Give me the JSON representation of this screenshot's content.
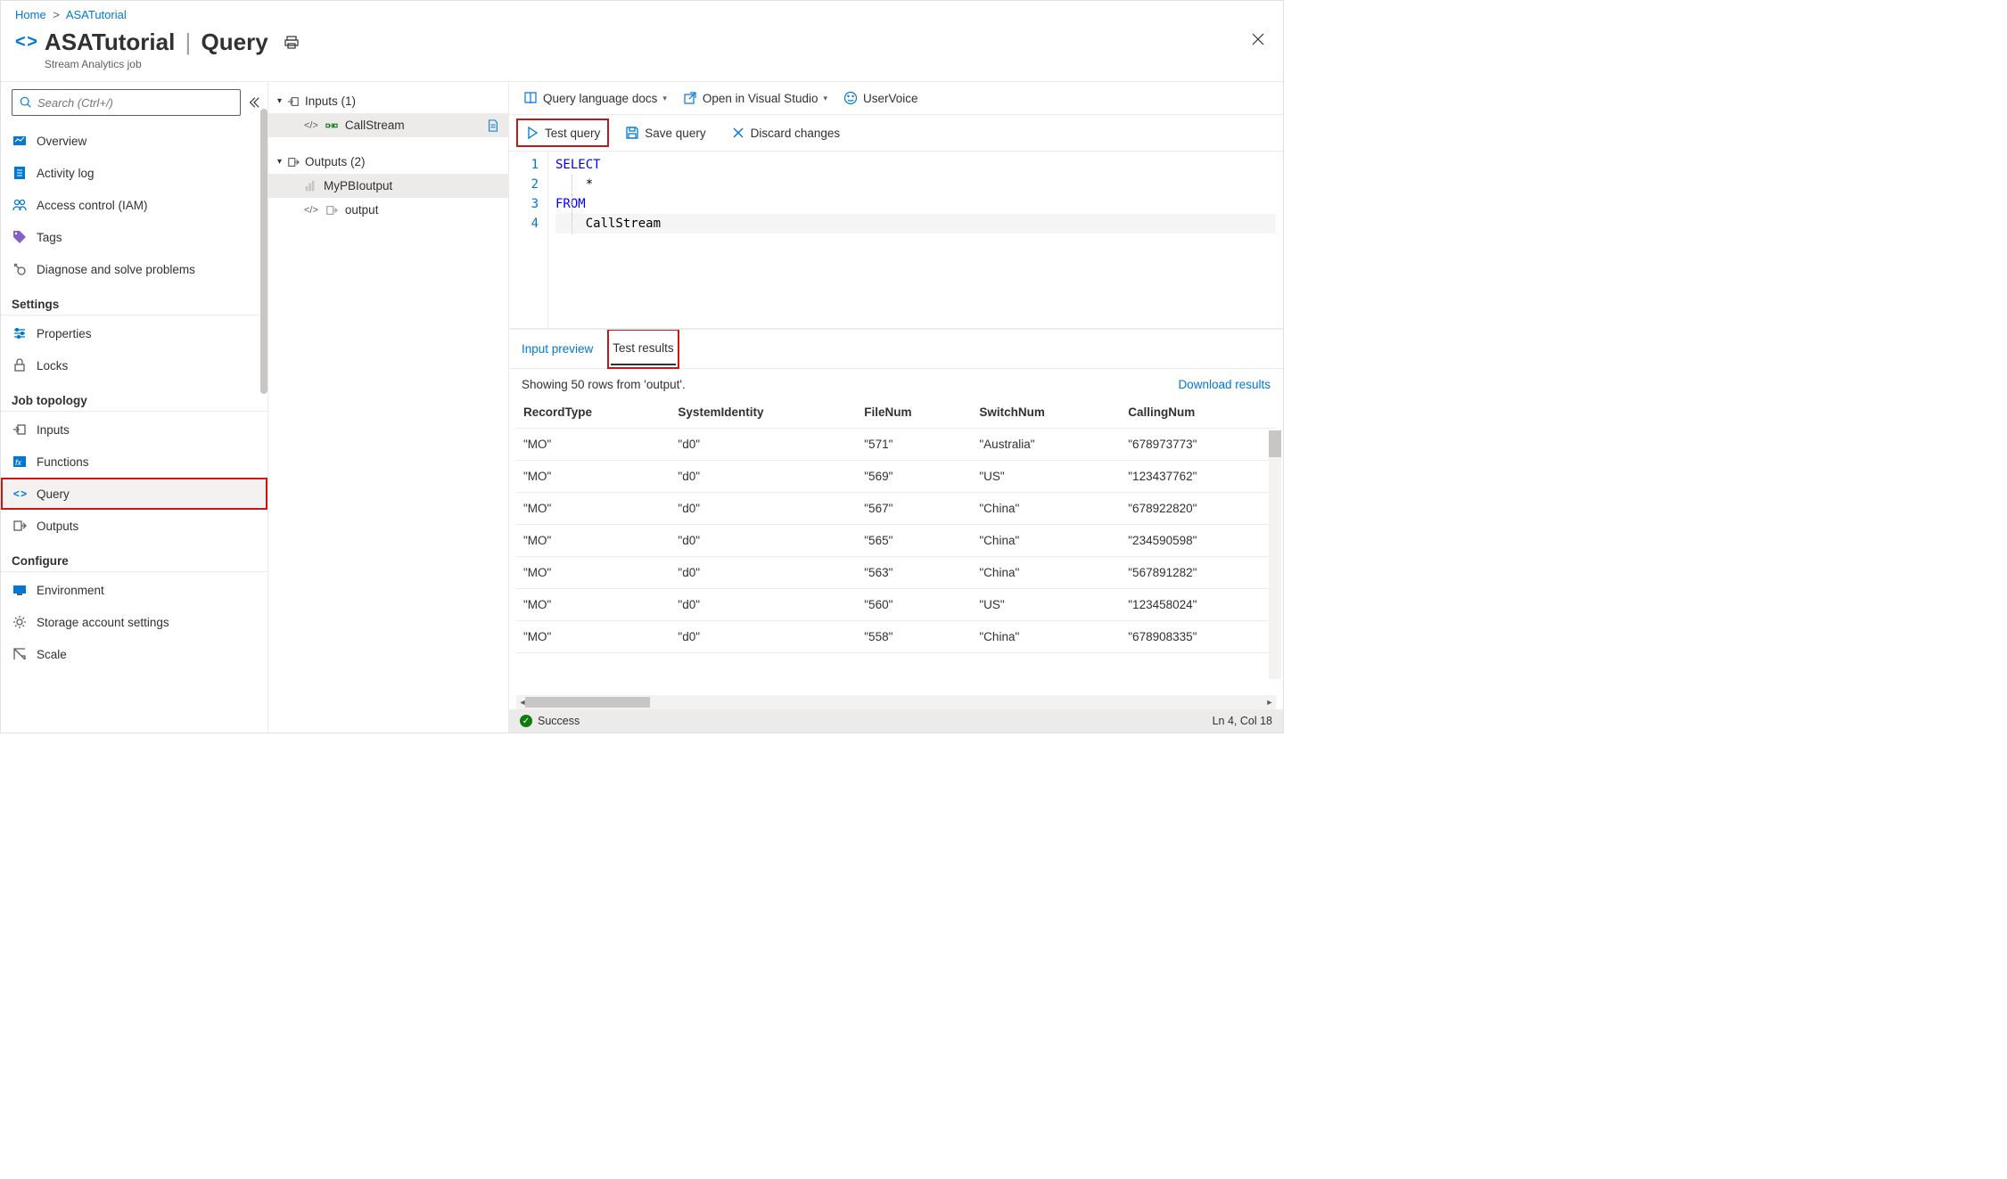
{
  "breadcrumb": {
    "home": "Home",
    "resource": "ASATutorial"
  },
  "header": {
    "title_main": "ASATutorial",
    "title_sub": "Query",
    "subtitle": "Stream Analytics job"
  },
  "sidebar": {
    "search_placeholder": "Search (Ctrl+/)",
    "items": {
      "overview": "Overview",
      "activity_log": "Activity log",
      "iam": "Access control (IAM)",
      "tags": "Tags",
      "diagnose": "Diagnose and solve problems"
    },
    "sections": {
      "settings": "Settings",
      "settings_items": {
        "properties": "Properties",
        "locks": "Locks"
      },
      "job_topology": "Job topology",
      "job_topology_items": {
        "inputs": "Inputs",
        "functions": "Functions",
        "query": "Query",
        "outputs": "Outputs"
      },
      "configure": "Configure",
      "configure_items": {
        "environment": "Environment",
        "storage": "Storage account settings",
        "scale": "Scale"
      }
    }
  },
  "io": {
    "inputs_label": "Inputs (1)",
    "input_items": [
      "CallStream"
    ],
    "outputs_label": "Outputs (2)",
    "output_items": [
      "MyPBIoutput",
      "output"
    ]
  },
  "top_links": {
    "docs": "Query language docs",
    "vs": "Open in Visual Studio",
    "uservoice": "UserVoice"
  },
  "editor_toolbar": {
    "test": "Test query",
    "save": "Save query",
    "discard": "Discard changes"
  },
  "code": {
    "l1": "SELECT",
    "l2": "    *",
    "l3": "FROM",
    "l4": "    CallStream"
  },
  "results": {
    "tab_input_preview": "Input preview",
    "tab_test_results": "Test results",
    "showing": "Showing 50 rows from 'output'.",
    "download": "Download results",
    "columns": [
      "RecordType",
      "SystemIdentity",
      "FileNum",
      "SwitchNum",
      "CallingNum"
    ],
    "rows": [
      [
        "\"MO\"",
        "\"d0\"",
        "\"571\"",
        "\"Australia\"",
        "\"678973773\""
      ],
      [
        "\"MO\"",
        "\"d0\"",
        "\"569\"",
        "\"US\"",
        "\"123437762\""
      ],
      [
        "\"MO\"",
        "\"d0\"",
        "\"567\"",
        "\"China\"",
        "\"678922820\""
      ],
      [
        "\"MO\"",
        "\"d0\"",
        "\"565\"",
        "\"China\"",
        "\"234590598\""
      ],
      [
        "\"MO\"",
        "\"d0\"",
        "\"563\"",
        "\"China\"",
        "\"567891282\""
      ],
      [
        "\"MO\"",
        "\"d0\"",
        "\"560\"",
        "\"US\"",
        "\"123458024\""
      ],
      [
        "\"MO\"",
        "\"d0\"",
        "\"558\"",
        "\"China\"",
        "\"678908335\""
      ]
    ]
  },
  "status": {
    "text": "Success",
    "pos": "Ln 4, Col 18"
  }
}
